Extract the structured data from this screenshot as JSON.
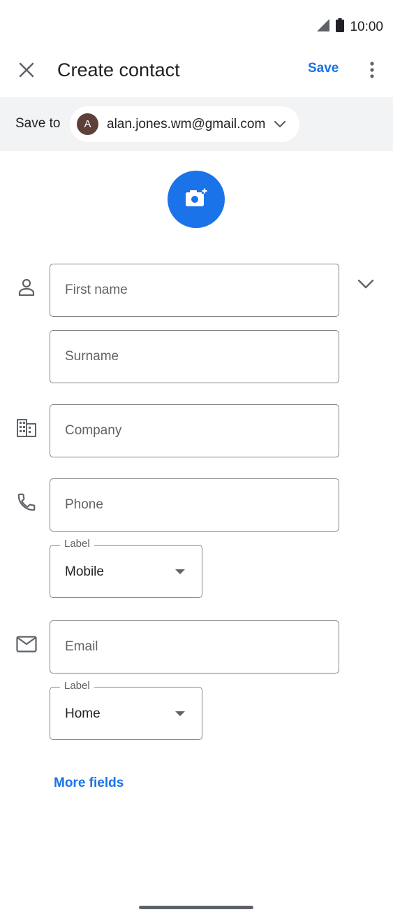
{
  "status_bar": {
    "time": "10:00",
    "signal_icon": "signal-icon",
    "battery_icon": "battery-icon"
  },
  "app_bar": {
    "title": "Create contact",
    "save_label": "Save",
    "close_icon": "close-icon",
    "more_icon": "more-vert-icon"
  },
  "save_to": {
    "label": "Save to",
    "account": {
      "avatar_letter": "A",
      "email": "alan.jones.wm@gmail.com",
      "avatar_color": "#5d4037"
    }
  },
  "form": {
    "first_name_placeholder": "First name",
    "surname_placeholder": "Surname",
    "company_placeholder": "Company",
    "phone_placeholder": "Phone",
    "phone_label": {
      "legend": "Label",
      "value": "Mobile"
    },
    "email_placeholder": "Email",
    "email_label": {
      "legend": "Label",
      "value": "Home"
    }
  },
  "more_fields_label": "More fields",
  "colors": {
    "accent": "#1a73e8",
    "border": "#80868b",
    "save_to_bg": "#f1f3f4"
  }
}
